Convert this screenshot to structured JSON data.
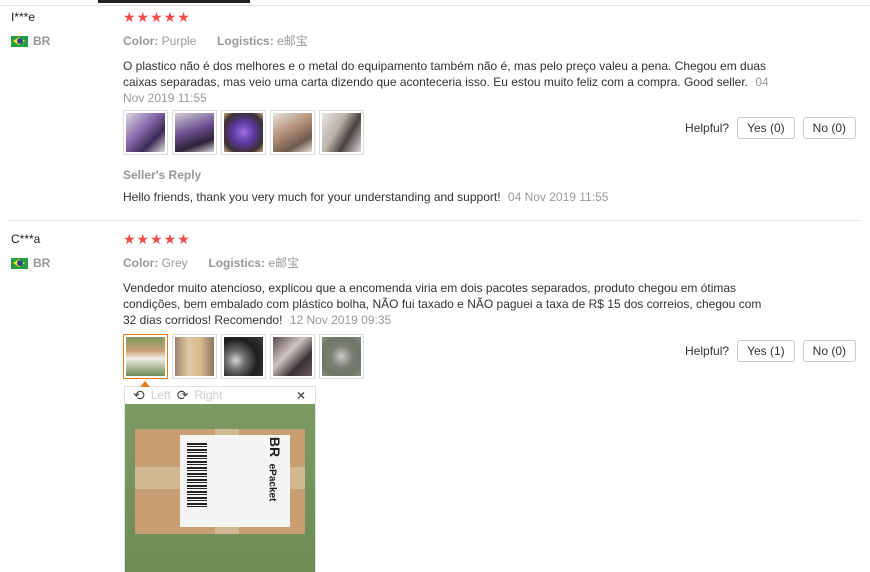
{
  "reviews": [
    {
      "user": "I***e",
      "country": "BR",
      "stars": "★★★★★",
      "color_label": "Color:",
      "color_value": "Purple",
      "logistics_label": "Logistics:",
      "logistics_value": "e邮宝",
      "text": "O plastico não é dos melhores e o metal do equipamento também não é, mas pelo preço valeu a pena. Chegou em duas caixas separadas, mas veio uma carta dizendo que aconteceria isso. Eu estou muito feliz com a compra. Good seller.",
      "date": "04 Nov 2019 11:55",
      "helpful_label": "Helpful?",
      "yes_label": "Yes (0)",
      "no_label": "No (0)",
      "reply_title": "Seller's Reply",
      "reply_text": "Hello friends, thank you very much for your understanding and support!",
      "reply_date": "04 Nov 2019 11:55"
    },
    {
      "user": "C***a",
      "country": "BR",
      "stars": "★★★★★",
      "color_label": "Color:",
      "color_value": "Grey",
      "logistics_label": "Logistics:",
      "logistics_value": "e邮宝",
      "text": "Vendedor muito atencioso, explicou que a encomenda viria em dois pacotes separados, produto chegou em ótimas condições, bem embalado com plástico bolha, NÃO fui taxado e NÃO paguei a taxa de R$ 15 dos correios, chegou com 32 dias corridos! Recomendo!",
      "date": "12 Nov 2019 09:35",
      "helpful_label": "Helpful?",
      "yes_label": "Yes (1)",
      "no_label": "No (0)"
    }
  ],
  "viewer": {
    "left_label": "Left",
    "right_label": "Right",
    "close_glyph": "×",
    "rotate_left_glyph": "⟲",
    "rotate_right_glyph": "⟳",
    "package_label_country": "BR",
    "package_label_service": "ePacket"
  },
  "colors": {
    "star": "#f44a4a",
    "active_thumb_border": "#e87c1c"
  }
}
